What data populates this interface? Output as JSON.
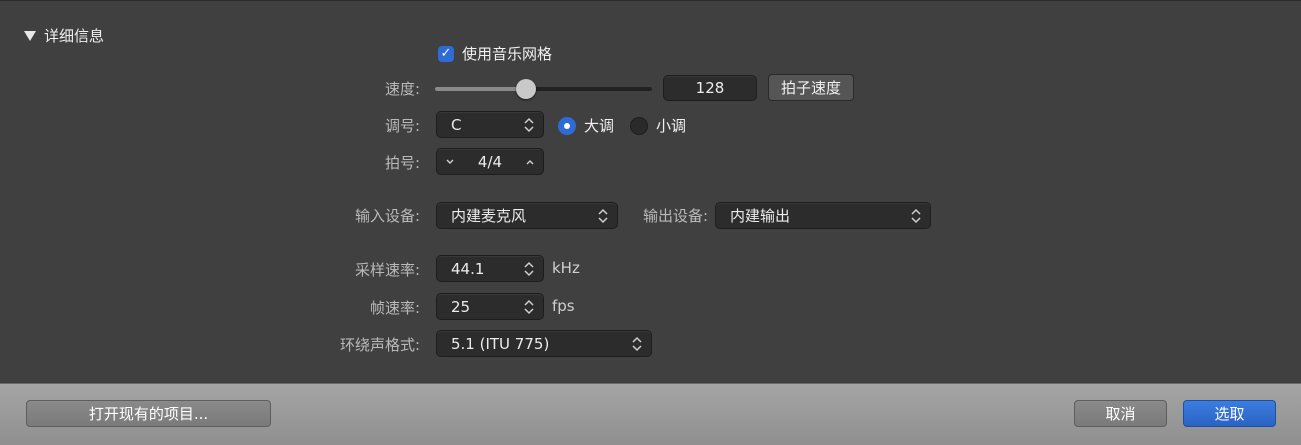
{
  "section": {
    "title": "详细信息"
  },
  "music_grid": {
    "label": "使用音乐网格",
    "checked": true
  },
  "tempo": {
    "label": "速度:",
    "value": "128",
    "slider_fraction": 0.42,
    "tap_button": "拍子速度"
  },
  "key": {
    "label": "调号:",
    "value": "C",
    "major_label": "大调",
    "minor_label": "小调",
    "selected": "major"
  },
  "time_signature": {
    "label": "拍号:",
    "value": "4/4"
  },
  "input_device": {
    "label": "输入设备:",
    "value": "内建麦克风"
  },
  "output_device": {
    "label": "输出设备:",
    "value": "内建输出"
  },
  "sample_rate": {
    "label": "采样速率:",
    "value": "44.1",
    "unit": "kHz"
  },
  "frame_rate": {
    "label": "帧速率:",
    "value": "25",
    "unit": "fps"
  },
  "surround_format": {
    "label": "环绕声格式:",
    "value": "5.1 (ITU 775)"
  },
  "footer": {
    "open_existing": "打开现有的项目...",
    "cancel": "取消",
    "choose": "选取"
  },
  "colors": {
    "accent": "#2f6bd4",
    "panel": "#404040"
  },
  "icons": {
    "stepper": "up-down-chevron-icon",
    "check": "checkmark-icon",
    "disclosure": "disclosure-triangle-icon"
  }
}
